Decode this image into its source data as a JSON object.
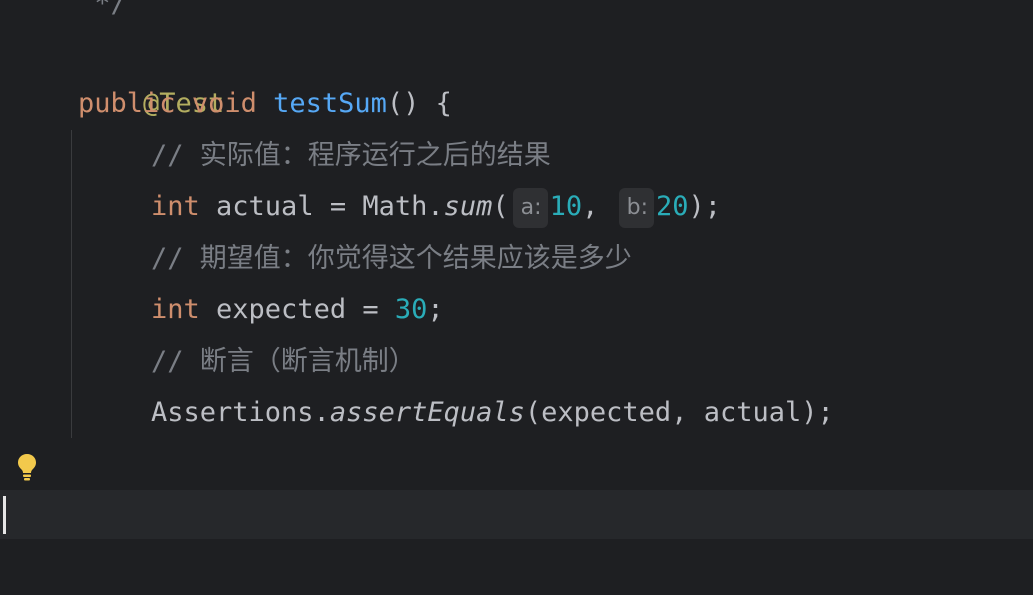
{
  "code": {
    "comment_end": " */",
    "annotation": "@Test",
    "sig_kw_public": "public",
    "sig_kw_void": "void",
    "sig_method": "testSum",
    "sig_tail": "() {",
    "comment_actual": "// 实际值：程序运行之后的结果",
    "actual_kw": "int",
    "actual_assign": " actual = Math.",
    "actual_call": "sum",
    "paren_open": "(",
    "hint_a": "a:",
    "arg_a": "10",
    "comma": ",",
    "hint_b": "b:",
    "arg_b": "20",
    "actual_end": ");",
    "comment_expected": "// 期望值：你觉得这个结果应该是多少",
    "expected_kw": "int",
    "expected_assign": " expected = ",
    "expected_value": "30",
    "semicolon": ";",
    "comment_assert": "// 断言（断言机制）",
    "assert_class": "Assertions.",
    "assert_method": "assertEquals",
    "assert_args": "(expected, actual);",
    "closing_brace": "}"
  },
  "icons": {
    "bulb": "lightbulb-icon"
  },
  "colors": {
    "background": "#1e1f22",
    "keyword": "#cf8e6d",
    "annotation": "#b3ae60",
    "method": "#56a8f5",
    "number": "#2aacb8",
    "comment": "#7a7e85",
    "text": "#bcbec4",
    "bulb": "#f2c94c"
  }
}
